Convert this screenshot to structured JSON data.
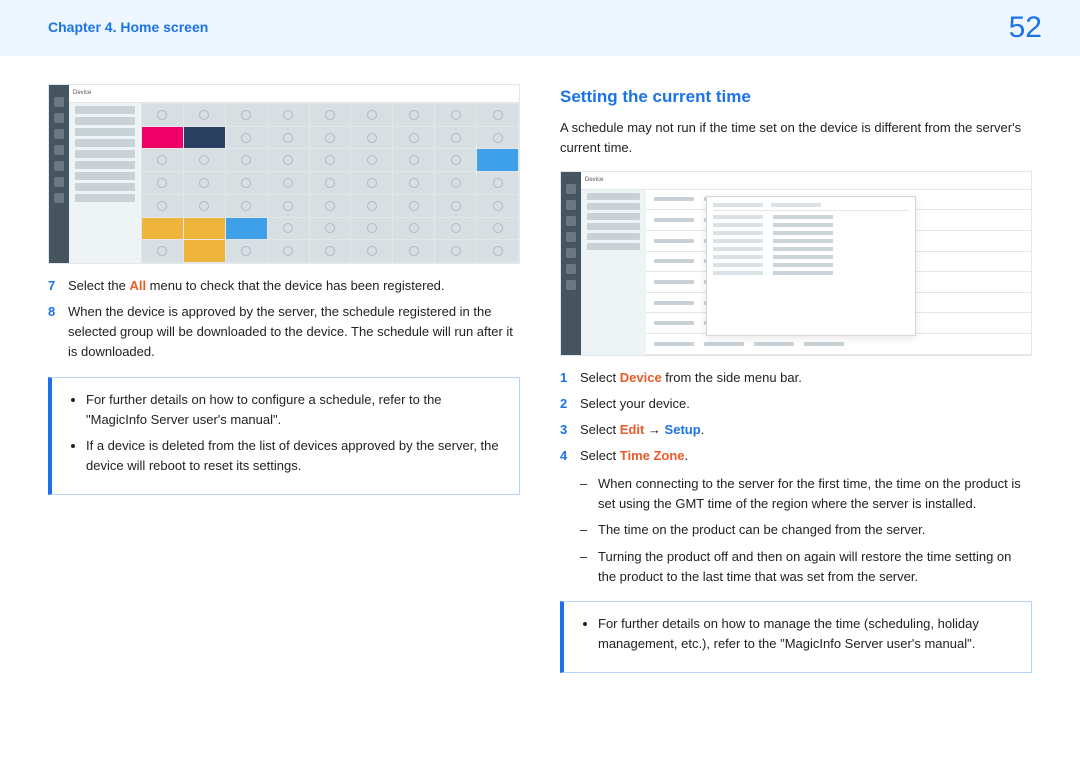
{
  "header": {
    "chapter": "Chapter 4. Home screen",
    "page": "52"
  },
  "left": {
    "steps": [
      {
        "n": "7",
        "parts": [
          "Select the ",
          "All",
          " menu to check that the device has been registered."
        ]
      },
      {
        "n": "8",
        "text": "When the device is approved by the server, the schedule registered in the selected group will be downloaded to the device. The schedule will run after it is downloaded."
      }
    ],
    "bullets": [
      "For further details on how to configure a schedule, refer to the \"MagicInfo Server user's manual\".",
      "If a device is deleted from the list of devices approved by the server, the device will reboot to reset its settings."
    ]
  },
  "right": {
    "heading": "Setting the current time",
    "intro": "A schedule may not run if the time set on the device is different from the server's current time.",
    "steps": [
      {
        "n": "1",
        "parts": [
          "Select ",
          "Device",
          " from the side menu bar."
        ]
      },
      {
        "n": "2",
        "text": "Select your device."
      },
      {
        "n": "3",
        "parts": [
          "Select ",
          "Edit",
          " → ",
          "Setup",
          "."
        ]
      },
      {
        "n": "4",
        "parts": [
          "Select ",
          "Time Zone",
          "."
        ]
      }
    ],
    "sub": [
      "When connecting to the server for the first time, the time on the product is set using the GMT time of the region where the server is installed.",
      "The time on the product can be changed from the server.",
      "Turning the product off and then on again will restore the time setting on the product to the last time that was set from the server."
    ],
    "bullets": [
      "For further details on how to manage the time (scheduling, holiday management, etc.), refer to the \"MagicInfo Server user's manual\"."
    ]
  },
  "thumb": {
    "label": "Device"
  }
}
